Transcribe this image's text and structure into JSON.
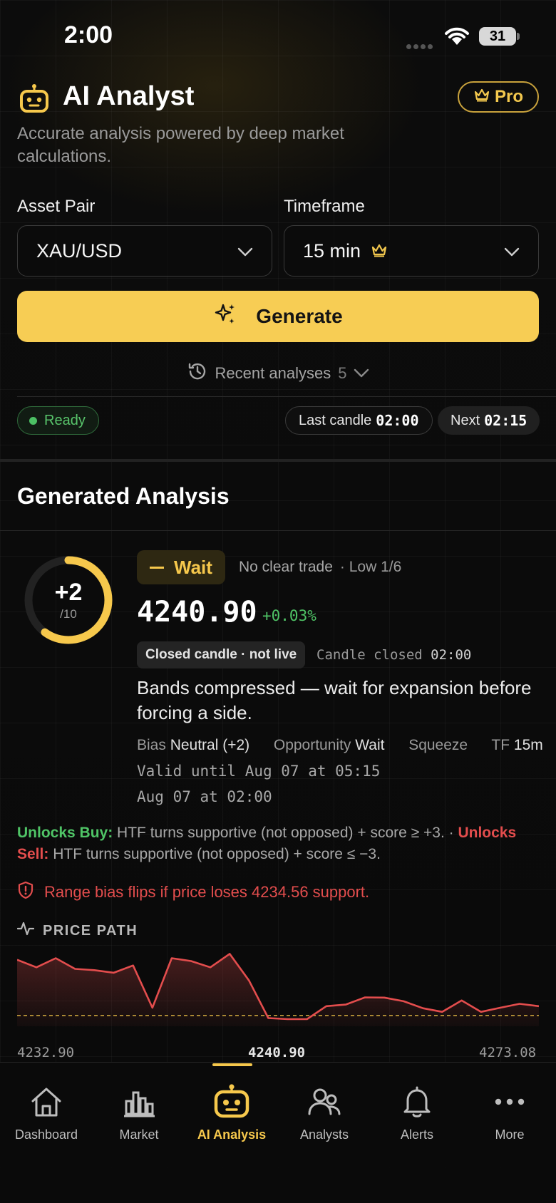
{
  "status_bar": {
    "time": "2:00",
    "battery": "31"
  },
  "header": {
    "title": "AI Analyst",
    "pro_label": "Pro",
    "subtitle": "Accurate analysis powered by deep market calculations."
  },
  "form": {
    "asset_label": "Asset Pair",
    "asset_value": "XAU/USD",
    "timeframe_label": "Timeframe",
    "timeframe_value": "15 min",
    "generate_label": "Generate",
    "recent_label": "Recent analyses",
    "recent_count": "5"
  },
  "status": {
    "ready_label": "Ready",
    "last_candle_label": "Last candle",
    "last_candle_value": "02:00",
    "next_label": "Next",
    "next_value": "02:15"
  },
  "analysis": {
    "section_title": "Generated Analysis",
    "score": "+2",
    "score_max": "/10",
    "score_fraction": 0.6,
    "signal": "Wait",
    "signal_desc": "No clear trade",
    "level": "· Low 1/6",
    "price": "4240.90",
    "change": "+0.03%",
    "closed_chip": "Closed candle · not live",
    "candle_closed_label": "Candle closed",
    "candle_closed_value": "02:00",
    "summary": "Bands compressed — wait for expansion before forcing a side.",
    "bias_label": "Bias",
    "bias_value": "Neutral (+2)",
    "opportunity_label": "Opportunity",
    "opportunity_value": "Wait",
    "squeeze_label": "Squeeze",
    "tf_label": "TF",
    "tf_value": "15m",
    "valid_until": "Valid until Aug 07 at 05:15",
    "generated_at": "Aug 07 at 02:00",
    "unlocks_buy_label": "Unlocks Buy:",
    "unlocks_buy_text": "HTF turns supportive (not opposed) + score ≥ +3. ·",
    "unlocks_sell_label": "Unlocks Sell:",
    "unlocks_sell_text": "HTF turns supportive (not opposed) + score ≤ −3.",
    "risk_text": "Range bias flips if price loses 4234.56 support."
  },
  "price_path": {
    "label": "PRICE PATH",
    "low_label": "4232.90",
    "current_label": "4240.90",
    "high_label": "4273.08"
  },
  "chart_data": {
    "type": "area",
    "title": "PRICE PATH",
    "x": [
      0,
      1,
      2,
      3,
      4,
      5,
      6,
      7,
      8,
      9,
      10,
      11,
      12,
      13,
      14,
      15,
      16,
      17,
      18,
      19,
      20,
      21,
      22,
      23,
      24,
      25,
      26,
      27,
      28,
      29
    ],
    "values": [
      4263.5,
      4260.6,
      4264.1,
      4260.0,
      4259.5,
      4258.5,
      4261.3,
      4245.0,
      4264.1,
      4263.0,
      4260.6,
      4265.8,
      4255.5,
      4241.0,
      4240.6,
      4240.6,
      4245.6,
      4246.2,
      4249.0,
      4248.9,
      4247.5,
      4244.8,
      4243.4,
      4247.8,
      4243.4,
      4245.0,
      4246.5,
      4245.6
    ],
    "reference_line": 4242.0,
    "ylim": [
      4232.9,
      4273.08
    ],
    "grid": false,
    "colors": {
      "line": "#e34d4d",
      "reference": "#c9a23c"
    }
  },
  "nav": {
    "items": [
      {
        "label": "Dashboard",
        "icon": "home-icon"
      },
      {
        "label": "Market",
        "icon": "bar-chart-icon"
      },
      {
        "label": "AI Analysis",
        "icon": "robot-icon"
      },
      {
        "label": "Analysts",
        "icon": "users-icon"
      },
      {
        "label": "Alerts",
        "icon": "bell-icon"
      },
      {
        "label": "More",
        "icon": "more-icon"
      }
    ],
    "active_index": 2
  },
  "colors": {
    "accent": "#f7cd54",
    "positive": "#4fc466",
    "negative": "#e34d4d",
    "background": "#0b0b0b"
  }
}
